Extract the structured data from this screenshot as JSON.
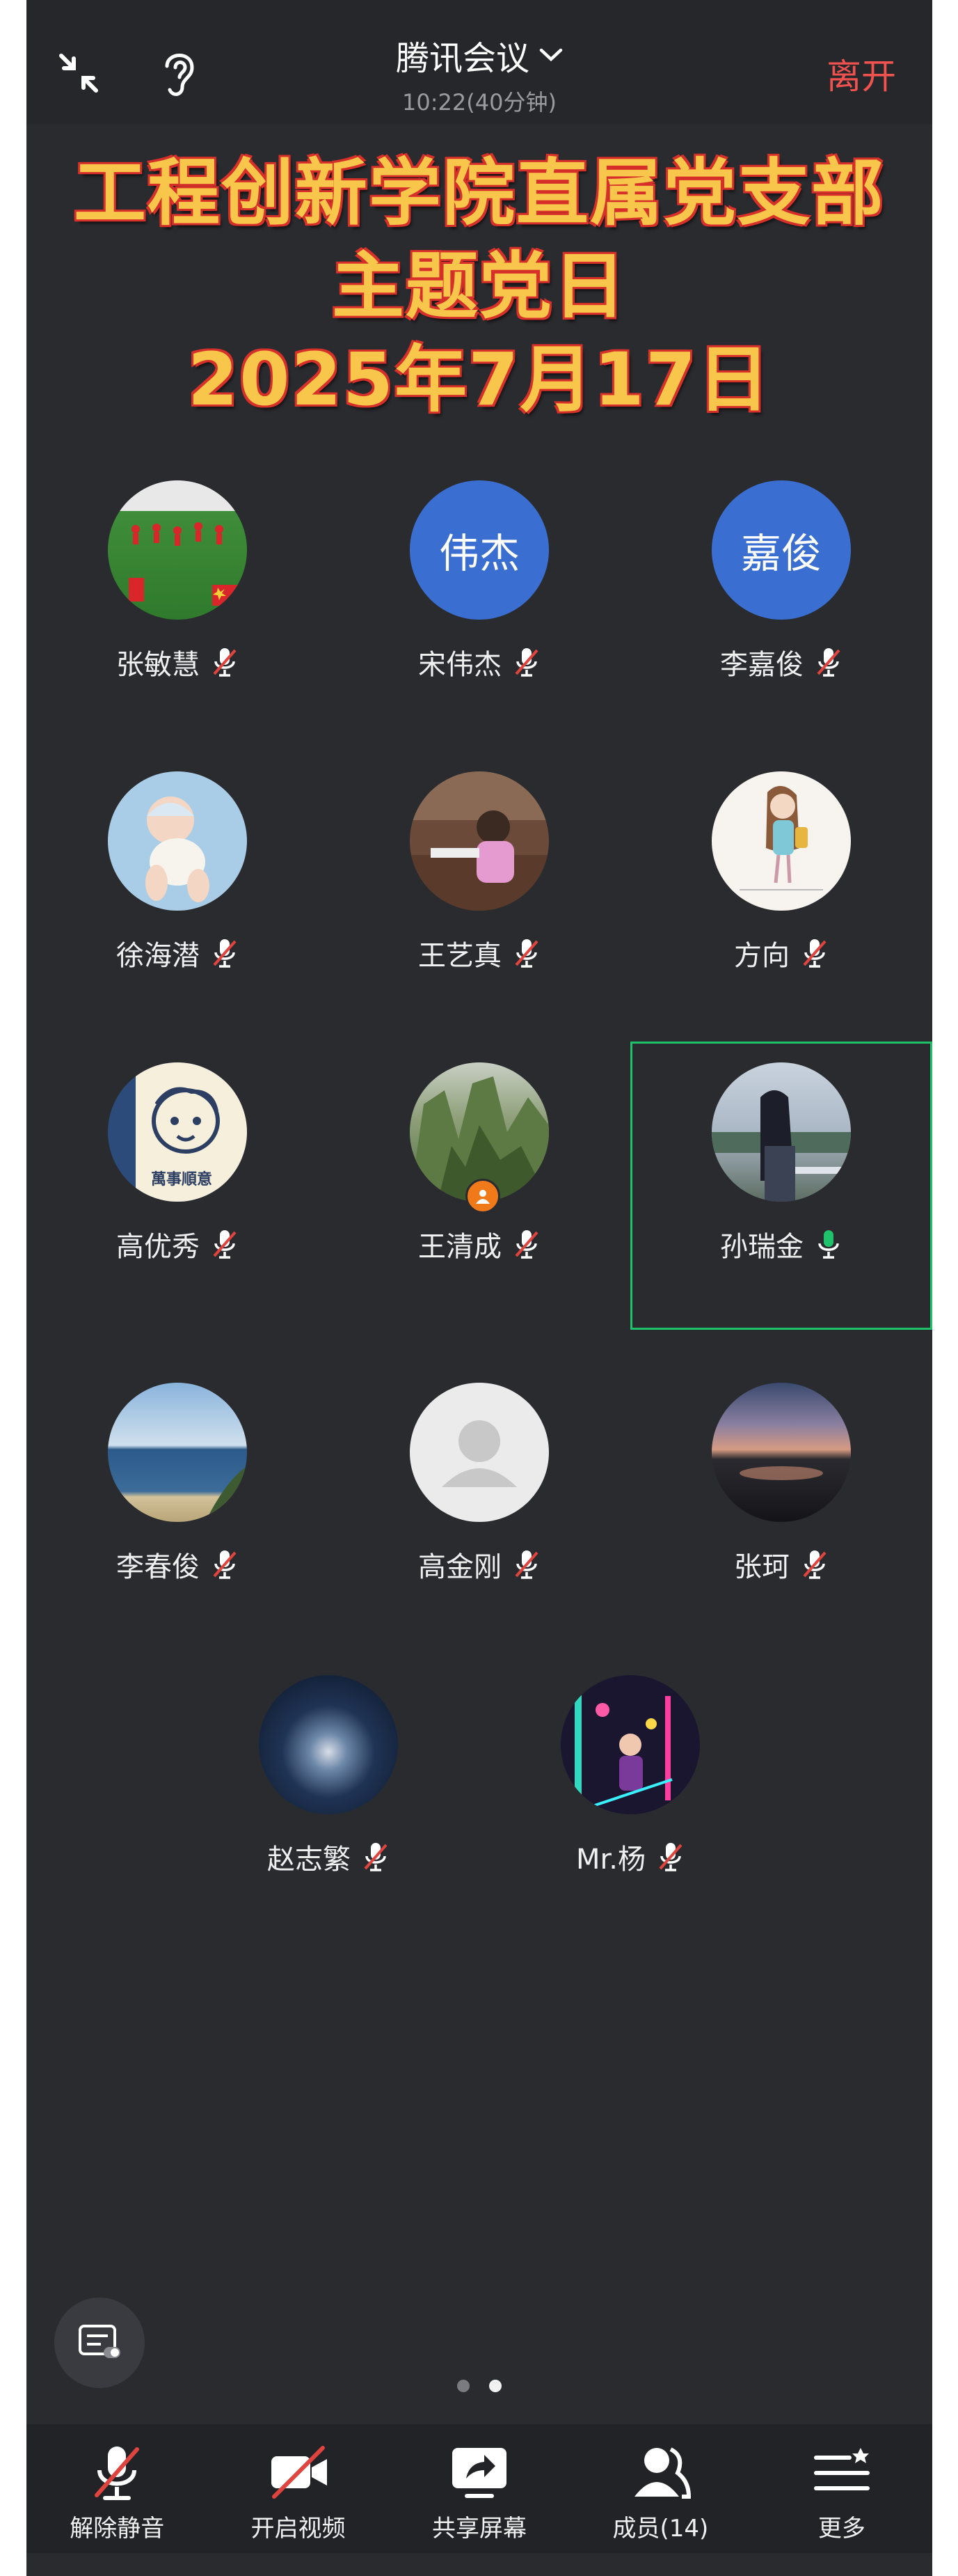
{
  "header": {
    "title": "腾讯会议",
    "time": "10:22(40分钟)",
    "leave_label": "离开"
  },
  "banner": {
    "line1": "工程创新学院直属党支部",
    "line2": "主题党日",
    "line3": "2025年7月17日"
  },
  "participants": [
    {
      "name": "张敏慧",
      "mic": "muted",
      "avatar": "photo-soccer-field"
    },
    {
      "name": "宋伟杰",
      "mic": "muted",
      "avatar_text": "伟杰",
      "avatar_color": "#3a6fd1"
    },
    {
      "name": "李嘉俊",
      "mic": "muted",
      "avatar_text": "嘉俊",
      "avatar_color": "#3a6fd1"
    },
    {
      "name": "徐海潜",
      "mic": "muted",
      "avatar": "photo-baby"
    },
    {
      "name": "王艺真",
      "mic": "muted",
      "avatar": "photo-child-desk"
    },
    {
      "name": "方向",
      "mic": "muted",
      "avatar": "drawing-girl"
    },
    {
      "name": "高优秀",
      "mic": "muted",
      "avatar": "cartoon-face",
      "avatar_caption": "萬事順意"
    },
    {
      "name": "王清成",
      "mic": "muted",
      "avatar": "photo-mountain",
      "host": true
    },
    {
      "name": "孙瑞金",
      "mic": "speaking",
      "avatar": "photo-lakeside-woman"
    },
    {
      "name": "李春俊",
      "mic": "muted",
      "avatar": "photo-seaside"
    },
    {
      "name": "高金刚",
      "mic": "muted",
      "avatar": "default-user"
    },
    {
      "name": "张珂",
      "mic": "muted",
      "avatar": "photo-sunset-lake"
    },
    {
      "name": "赵志繁",
      "mic": "muted",
      "avatar": "photo-galaxy"
    },
    {
      "name": "Mr.杨",
      "mic": "muted",
      "avatar": "photo-neon"
    }
  ],
  "pagination": {
    "current": 2,
    "total": 2
  },
  "toolbar": {
    "unmute_label": "解除静音",
    "video_label": "开启视频",
    "share_label": "共享屏幕",
    "members_label": "成员(14)",
    "more_label": "更多"
  },
  "colors": {
    "background": "#2a2b2f",
    "leave": "#f0524f",
    "speaking": "#1fc26b",
    "muted_slash": "#e0443e",
    "banner_text": "#f7c64a"
  }
}
